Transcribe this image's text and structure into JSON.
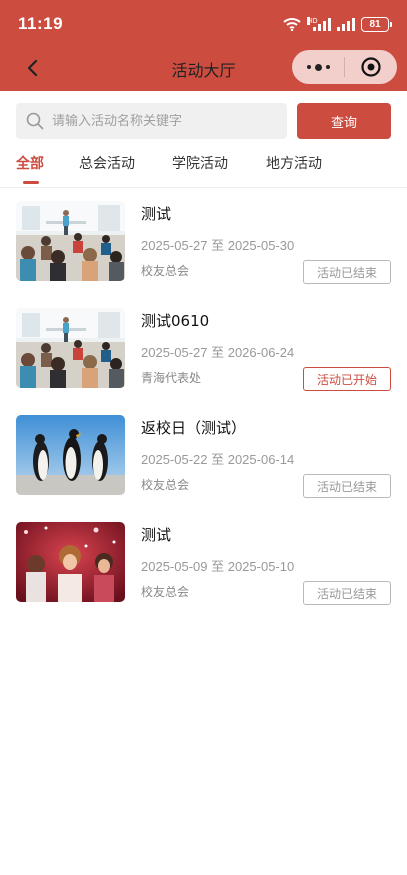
{
  "status_bar": {
    "time": "11:19",
    "signal_label": "HD",
    "battery": "81"
  },
  "nav": {
    "title": "活动大厅",
    "back_icon": "chevron-left-icon",
    "more_icon": "more-dots-icon",
    "close_icon": "target-close-icon"
  },
  "search": {
    "placeholder": "请输入活动名称关键字",
    "value": "",
    "button_label": "查询"
  },
  "tabs": [
    {
      "label": "全部",
      "active": true
    },
    {
      "label": "总会活动",
      "active": false
    },
    {
      "label": "学院活动",
      "active": false
    },
    {
      "label": "地方活动",
      "active": false
    }
  ],
  "activities": [
    {
      "title": "测试",
      "date_range": "2025-05-27 至 2025-05-30",
      "organizer": "校友总会",
      "status": "活动已结束",
      "status_active": false,
      "image": "classroom-photo"
    },
    {
      "title": "测试0610",
      "date_range": "2025-05-27 至 2026-06-24",
      "organizer": "青海代表处",
      "status": "活动已开始",
      "status_active": true,
      "image": "classroom-photo"
    },
    {
      "title": "返校日（测试）",
      "date_range": "2025-05-22 至 2025-06-14",
      "organizer": "校友总会",
      "status": "活动已结束",
      "status_active": false,
      "image": "penguins-photo"
    },
    {
      "title": "测试",
      "date_range": "2025-05-09 至 2025-05-10",
      "organizer": "校友总会",
      "status": "活动已结束",
      "status_active": false,
      "image": "party-photo"
    }
  ],
  "colors": {
    "brand": "#cc4c40",
    "muted_text": "#999999",
    "tag_border": "#b9b9b9"
  }
}
